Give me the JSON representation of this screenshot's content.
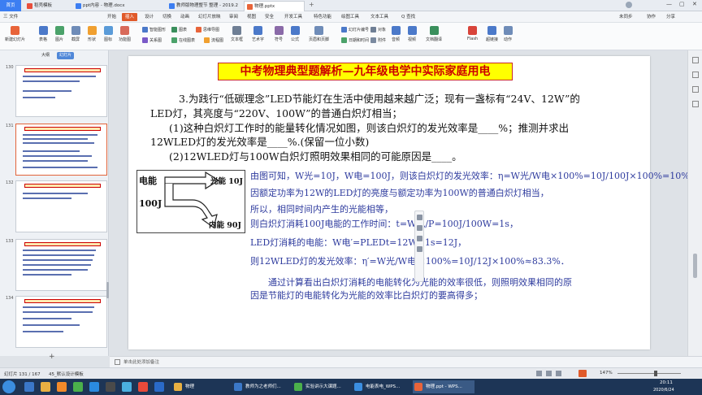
{
  "tabs": [
    {
      "label": "首页"
    },
    {
      "label": "稻壳模板"
    },
    {
      "label": "ppt内容 - 物理.docx"
    },
    {
      "label": "教师版物理整节 整理 - 2019.2"
    },
    {
      "label": "物理.pptx"
    }
  ],
  "menu": {
    "items": [
      "三 文件",
      "开始",
      "插入",
      "设计",
      "切换",
      "动画",
      "幻灯片放映",
      "审阅",
      "视图",
      "安全",
      "开发工具",
      "特色功能",
      "绘图工具",
      "文本工具",
      "Q 查找"
    ],
    "right": [
      "未同步",
      "协作",
      "分享"
    ]
  },
  "ribbon": {
    "big": [
      "新建幻灯片",
      "表格",
      "图片",
      "截屏",
      "形状",
      "图标",
      "功能图",
      "智能图形",
      "关系图",
      "在线图表",
      "流程图",
      "文本框",
      "艺术字",
      "符号",
      "公式",
      "页眉和页脚",
      "日期和时间",
      "附件",
      "音频",
      "视频",
      "文档翻译",
      "Flash",
      "超链接",
      "动作"
    ],
    "small": [
      "思维导图",
      "幻灯片编号",
      "对象",
      "图表"
    ]
  },
  "left_panel": {
    "tabs": [
      "大纲",
      "幻灯片"
    ],
    "thumbs": [
      {
        "num": "130"
      },
      {
        "num": "131"
      },
      {
        "num": "132"
      },
      {
        "num": "133"
      },
      {
        "num": "134"
      }
    ],
    "add": "+"
  },
  "slide": {
    "title": "中考物理典型题解析—九年级电学中实际家庭用电",
    "q_lines": [
      "3.为践行“低碳理念”LED节能灯在生活中使用越来越广泛；现有一盏标有“24V、12W”的",
      "LED灯，其亮度与“220V、100W”的普通白炽灯相当；",
      "(1)这种白炽灯工作时的能量转化情况如图，则该白炽灯的发光效率是____%；推测并求出",
      "12WLED灯的发光效率是____%.(保留一位小数)",
      "(2)12WLED灯与100W白炽灯照明效果相同的可能原因是____。"
    ],
    "diagram": {
      "left1": "电能",
      "left2": "100J",
      "top": "光能 10J",
      "bottom": "内能 90J"
    },
    "ans_lines": [
      "由图可知，W光=10J，W电=100J，则该白炽灯的发光效率：η=W光/W电×100%=10J/100J×100%=10%；",
      "因额定功率为12W的LED灯的亮度与额定功率为100W的普通白炽灯相当，",
      "所以，相同时间内产生的光能相等，",
      "则白炽灯消耗100J电能的工作时间：t=W电/P=100J/100W=1s，",
      "LED灯消耗的电能：W电′=PLEDt=12W×1s=12J，",
      "则12WLED灯的发光效率：η′=W光/W电′×100%=10J/12J×100%≈83.3%．",
      "通过计算看出白炽灯消耗的电能转化为光能的效率很低，则照明效果相同的原",
      "因是节能灯的电能转化为光能的效率比白炽灯的要高得多；"
    ]
  },
  "notes": "单击此处添加备注",
  "status": {
    "slide": "幻灯片 131 / 167",
    "theme": "45_默认设计模板",
    "zoom": "147%"
  },
  "taskbar": {
    "apps": [
      "物理",
      "教师为之老师们...",
      "实验讲示大课题...",
      "电能表电_WPS...",
      "物理.ppt - WPS..."
    ],
    "time": "20:11",
    "date": "2020/6/24"
  },
  "colors": {
    "accent": "#e05a2a",
    "title_bg": "#ffff00",
    "title_text": "#cc0000",
    "answer_text": "#2e3b9e"
  }
}
